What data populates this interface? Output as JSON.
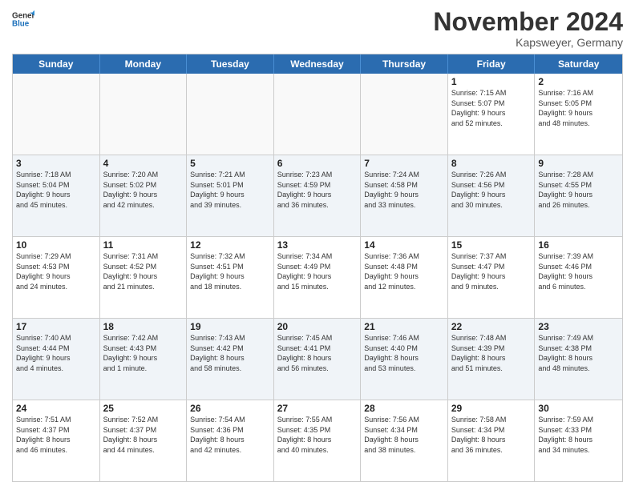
{
  "header": {
    "logo_line1": "General",
    "logo_line2": "Blue",
    "title": "November 2024",
    "subtitle": "Kapsweyer, Germany"
  },
  "weekdays": [
    "Sunday",
    "Monday",
    "Tuesday",
    "Wednesday",
    "Thursday",
    "Friday",
    "Saturday"
  ],
  "rows": [
    [
      {
        "day": "",
        "detail": ""
      },
      {
        "day": "",
        "detail": ""
      },
      {
        "day": "",
        "detail": ""
      },
      {
        "day": "",
        "detail": ""
      },
      {
        "day": "",
        "detail": ""
      },
      {
        "day": "1",
        "detail": "Sunrise: 7:15 AM\nSunset: 5:07 PM\nDaylight: 9 hours\nand 52 minutes."
      },
      {
        "day": "2",
        "detail": "Sunrise: 7:16 AM\nSunset: 5:05 PM\nDaylight: 9 hours\nand 48 minutes."
      }
    ],
    [
      {
        "day": "3",
        "detail": "Sunrise: 7:18 AM\nSunset: 5:04 PM\nDaylight: 9 hours\nand 45 minutes."
      },
      {
        "day": "4",
        "detail": "Sunrise: 7:20 AM\nSunset: 5:02 PM\nDaylight: 9 hours\nand 42 minutes."
      },
      {
        "day": "5",
        "detail": "Sunrise: 7:21 AM\nSunset: 5:01 PM\nDaylight: 9 hours\nand 39 minutes."
      },
      {
        "day": "6",
        "detail": "Sunrise: 7:23 AM\nSunset: 4:59 PM\nDaylight: 9 hours\nand 36 minutes."
      },
      {
        "day": "7",
        "detail": "Sunrise: 7:24 AM\nSunset: 4:58 PM\nDaylight: 9 hours\nand 33 minutes."
      },
      {
        "day": "8",
        "detail": "Sunrise: 7:26 AM\nSunset: 4:56 PM\nDaylight: 9 hours\nand 30 minutes."
      },
      {
        "day": "9",
        "detail": "Sunrise: 7:28 AM\nSunset: 4:55 PM\nDaylight: 9 hours\nand 26 minutes."
      }
    ],
    [
      {
        "day": "10",
        "detail": "Sunrise: 7:29 AM\nSunset: 4:53 PM\nDaylight: 9 hours\nand 24 minutes."
      },
      {
        "day": "11",
        "detail": "Sunrise: 7:31 AM\nSunset: 4:52 PM\nDaylight: 9 hours\nand 21 minutes."
      },
      {
        "day": "12",
        "detail": "Sunrise: 7:32 AM\nSunset: 4:51 PM\nDaylight: 9 hours\nand 18 minutes."
      },
      {
        "day": "13",
        "detail": "Sunrise: 7:34 AM\nSunset: 4:49 PM\nDaylight: 9 hours\nand 15 minutes."
      },
      {
        "day": "14",
        "detail": "Sunrise: 7:36 AM\nSunset: 4:48 PM\nDaylight: 9 hours\nand 12 minutes."
      },
      {
        "day": "15",
        "detail": "Sunrise: 7:37 AM\nSunset: 4:47 PM\nDaylight: 9 hours\nand 9 minutes."
      },
      {
        "day": "16",
        "detail": "Sunrise: 7:39 AM\nSunset: 4:46 PM\nDaylight: 9 hours\nand 6 minutes."
      }
    ],
    [
      {
        "day": "17",
        "detail": "Sunrise: 7:40 AM\nSunset: 4:44 PM\nDaylight: 9 hours\nand 4 minutes."
      },
      {
        "day": "18",
        "detail": "Sunrise: 7:42 AM\nSunset: 4:43 PM\nDaylight: 9 hours\nand 1 minute."
      },
      {
        "day": "19",
        "detail": "Sunrise: 7:43 AM\nSunset: 4:42 PM\nDaylight: 8 hours\nand 58 minutes."
      },
      {
        "day": "20",
        "detail": "Sunrise: 7:45 AM\nSunset: 4:41 PM\nDaylight: 8 hours\nand 56 minutes."
      },
      {
        "day": "21",
        "detail": "Sunrise: 7:46 AM\nSunset: 4:40 PM\nDaylight: 8 hours\nand 53 minutes."
      },
      {
        "day": "22",
        "detail": "Sunrise: 7:48 AM\nSunset: 4:39 PM\nDaylight: 8 hours\nand 51 minutes."
      },
      {
        "day": "23",
        "detail": "Sunrise: 7:49 AM\nSunset: 4:38 PM\nDaylight: 8 hours\nand 48 minutes."
      }
    ],
    [
      {
        "day": "24",
        "detail": "Sunrise: 7:51 AM\nSunset: 4:37 PM\nDaylight: 8 hours\nand 46 minutes."
      },
      {
        "day": "25",
        "detail": "Sunrise: 7:52 AM\nSunset: 4:37 PM\nDaylight: 8 hours\nand 44 minutes."
      },
      {
        "day": "26",
        "detail": "Sunrise: 7:54 AM\nSunset: 4:36 PM\nDaylight: 8 hours\nand 42 minutes."
      },
      {
        "day": "27",
        "detail": "Sunrise: 7:55 AM\nSunset: 4:35 PM\nDaylight: 8 hours\nand 40 minutes."
      },
      {
        "day": "28",
        "detail": "Sunrise: 7:56 AM\nSunset: 4:34 PM\nDaylight: 8 hours\nand 38 minutes."
      },
      {
        "day": "29",
        "detail": "Sunrise: 7:58 AM\nSunset: 4:34 PM\nDaylight: 8 hours\nand 36 minutes."
      },
      {
        "day": "30",
        "detail": "Sunrise: 7:59 AM\nSunset: 4:33 PM\nDaylight: 8 hours\nand 34 minutes."
      }
    ]
  ],
  "alt_rows": [
    1,
    3
  ]
}
